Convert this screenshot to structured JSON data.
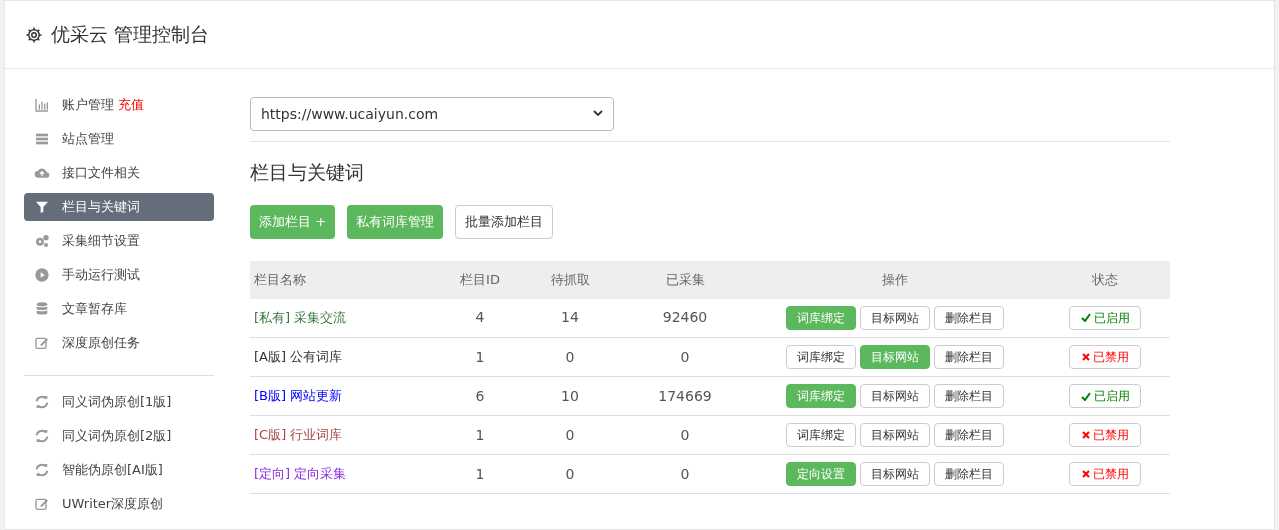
{
  "header": {
    "title": "优采云 管理控制台"
  },
  "sidebar": {
    "groups": [
      [
        {
          "label": "账户管理",
          "badge": "充值",
          "selected": false
        },
        {
          "label": "站点管理",
          "selected": false
        },
        {
          "label": "接口文件相关",
          "selected": false
        },
        {
          "label": "栏目与关键词",
          "selected": true
        },
        {
          "label": "采集细节设置",
          "selected": false
        },
        {
          "label": "手动运行测试",
          "selected": false
        },
        {
          "label": "文章暂存库",
          "selected": false
        },
        {
          "label": "深度原创任务",
          "selected": false
        }
      ],
      [
        {
          "label": "同义词伪原创[1版]",
          "selected": false
        },
        {
          "label": "同义词伪原创[2版]",
          "selected": false
        },
        {
          "label": "智能伪原创[AI版]",
          "selected": false
        },
        {
          "label": "UWriter深度原创",
          "selected": false
        }
      ]
    ]
  },
  "site_select": {
    "value": "https://www.ucaiyun.com"
  },
  "section_title": "栏目与关键词",
  "toolbar": [
    {
      "label": "添加栏目 +",
      "primary": true
    },
    {
      "label": "私有词库管理",
      "primary": true
    },
    {
      "label": "批量添加栏目",
      "primary": false
    }
  ],
  "table": {
    "columns": [
      "栏目名称",
      "栏目ID",
      "待抓取",
      "已采集",
      "操作",
      "状态"
    ],
    "rows": [
      {
        "tag": "[私有]",
        "name": "采集交流",
        "color": "#3c763d",
        "id": "4",
        "pending": "14",
        "collected": "92460",
        "actions": [
          {
            "label": "词库绑定",
            "primary": true
          },
          {
            "label": "目标网站",
            "primary": false
          },
          {
            "label": "删除栏目",
            "primary": false
          }
        ],
        "status": "已启用",
        "enabled": true
      },
      {
        "tag": "[A版]",
        "name": "公有词库",
        "color": "#333333",
        "id": "1",
        "pending": "0",
        "collected": "0",
        "actions": [
          {
            "label": "词库绑定",
            "primary": false
          },
          {
            "label": "目标网站",
            "primary": true
          },
          {
            "label": "删除栏目",
            "primary": false
          }
        ],
        "status": "已禁用",
        "enabled": false
      },
      {
        "tag": "[B版]",
        "name": "网站更新",
        "color": "#0000ff",
        "id": "6",
        "pending": "10",
        "collected": "174669",
        "actions": [
          {
            "label": "词库绑定",
            "primary": true
          },
          {
            "label": "目标网站",
            "primary": false
          },
          {
            "label": "删除栏目",
            "primary": false
          }
        ],
        "status": "已启用",
        "enabled": true
      },
      {
        "tag": "[C版]",
        "name": "行业词库",
        "color": "#a94442",
        "id": "1",
        "pending": "0",
        "collected": "0",
        "actions": [
          {
            "label": "词库绑定",
            "primary": false
          },
          {
            "label": "目标网站",
            "primary": false
          },
          {
            "label": "删除栏目",
            "primary": false
          }
        ],
        "status": "已禁用",
        "enabled": false
      },
      {
        "tag": "[定向]",
        "name": "定向采集",
        "color": "#8a2be2",
        "id": "1",
        "pending": "0",
        "collected": "0",
        "actions": [
          {
            "label": "定向设置",
            "primary": true
          },
          {
            "label": "目标网站",
            "primary": false
          },
          {
            "label": "删除栏目",
            "primary": false
          }
        ],
        "status": "已禁用",
        "enabled": false
      }
    ]
  }
}
